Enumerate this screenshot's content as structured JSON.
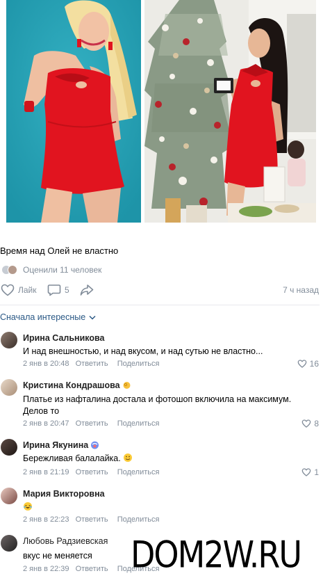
{
  "post": {
    "text": "Время над Олей не властно",
    "likes_summary": "Оценили 11 человек",
    "like_label": "Лайк",
    "comment_count": "5",
    "time": "7 ч назад"
  },
  "comments_sort": {
    "label": "Сначала интересные",
    "icon": "chevron-down-icon"
  },
  "comments": [
    {
      "author": "Ирина Сальникова",
      "text": "И над внешностью, и над вкусом, и над сутью не властно...",
      "date": "2 янв в 20:48",
      "reply": "Ответить",
      "share": "Поделиться",
      "likes": "16"
    },
    {
      "author": "Кристина Кондрашова",
      "author_emoji": "ok-hand-emoji",
      "text": "Платье из нафталина достала и фотошоп включила на максимум. Делов то",
      "date": "2 янв в 20:47",
      "reply": "Ответить",
      "share": "Поделиться",
      "likes": "8"
    },
    {
      "author": "Ирина Якунина",
      "author_emoji": "emoji-badge",
      "text": "Бережливая балалайка.",
      "text_emoji": "smile-emoji",
      "date": "2 янв в 21:19",
      "reply": "Ответить",
      "share": "Поделиться",
      "likes": "1"
    },
    {
      "author": "Мария Викторовна",
      "text_emoji": "laughing-emoji",
      "date": "2 янв в 22:23",
      "reply": "Ответить",
      "share": "Поделиться"
    },
    {
      "author": "Любовь Радзиевская",
      "text": "вкус не меняется",
      "date": "2 янв в 22:39",
      "reply": "Ответить",
      "share": "Поделиться"
    }
  ],
  "watermark": "DOM2W.RU",
  "colors": {
    "link": "#2a5885",
    "muted": "#818c99",
    "divider": "#e7e8ec",
    "dress_red": "#e1141f",
    "left_photo_bg": "#26a3b6"
  }
}
